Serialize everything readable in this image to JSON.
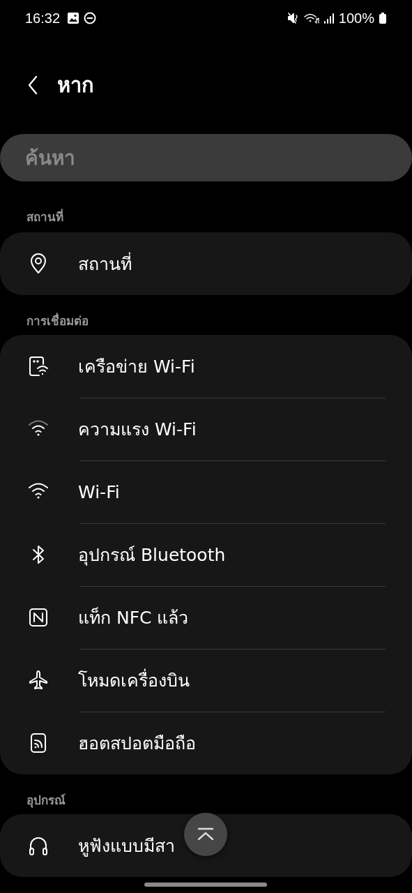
{
  "status_bar": {
    "time": "16:32",
    "battery": "100%"
  },
  "header": {
    "title": "หาก"
  },
  "search": {
    "placeholder": "ค้นหา"
  },
  "sections": [
    {
      "title": "สถานที่",
      "items": [
        {
          "label": "สถานที่"
        }
      ]
    },
    {
      "title": "การเชื่อมต่อ",
      "items": [
        {
          "label": "เครือข่าย Wi-Fi"
        },
        {
          "label": "ความแรง Wi-Fi"
        },
        {
          "label": "Wi-Fi"
        },
        {
          "label": "อุปกรณ์ Bluetooth"
        },
        {
          "label": "แท็ก NFC แล้ว"
        },
        {
          "label": "โหมดเครื่องบิน"
        },
        {
          "label": "ฮอตสปอตมือถือ"
        }
      ]
    },
    {
      "title": "อุปกรณ์",
      "items": [
        {
          "label": "หูฟังแบบมีสา"
        }
      ]
    }
  ]
}
